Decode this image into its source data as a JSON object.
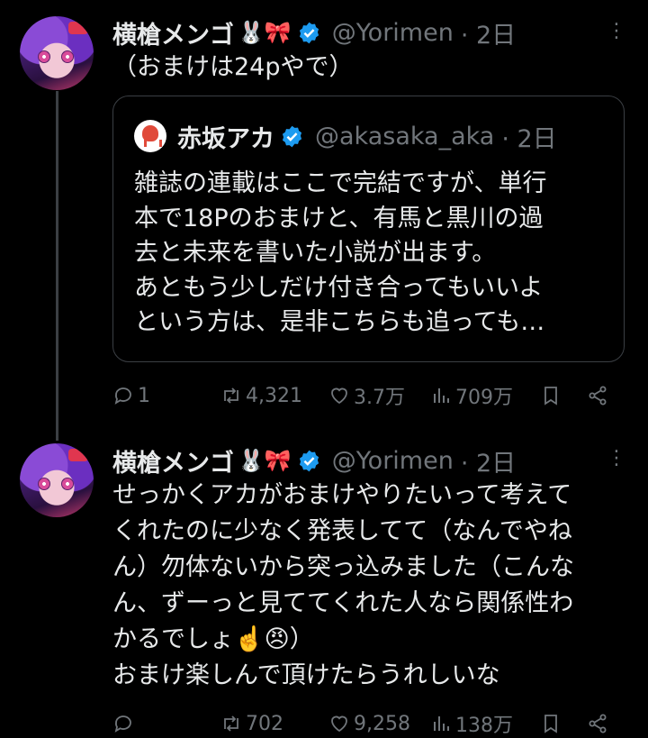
{
  "tweet1": {
    "name": "横槍メンゴ",
    "emojis": "🐰🎀",
    "handle": "@Yorimen",
    "time": "· 2日",
    "text": "（おまけは24pやで）",
    "quote": {
      "name": "赤坂アカ",
      "handle": "@akasaka_aka",
      "time": "· 2日",
      "text": "雑誌の連載はここで完結ですが、単行\n本で18Pのおまけと、有馬と黒川の過\n去と未来を書いた小説が出ます。\nあともう少しだけ付き合ってもいいよ\nという方は、是非こちらも追っても…"
    },
    "actions": {
      "replies": "1",
      "retweets": "4,321",
      "likes": "3.7万",
      "views": "709万"
    }
  },
  "tweet2": {
    "name": "横槍メンゴ",
    "emojis": "🐰🎀",
    "handle": "@Yorimen",
    "time": "· 2日",
    "text": "せっかくアカがおまけやりたいって考えて\nくれたのに少なく発表してて（なんでやね\nん）勿体ないから突っ込みました（こんな\nん、ずーっと見ててくれた人なら関係性わ\nかるでしょ☝️😠）\nおまけ楽しんで頂けたらうれしいな",
    "actions": {
      "replies": "",
      "retweets": "702",
      "likes": "9,258",
      "views": "138万"
    }
  },
  "icons": {
    "more": "more-dots-icon",
    "verified": "verified-badge-icon",
    "reply": "reply-icon",
    "retweet": "retweet-icon",
    "like": "heart-icon",
    "views": "views-icon",
    "bookmark": "bookmark-icon",
    "share": "share-icon"
  },
  "colors": {
    "background": "#000000",
    "text": "#e7e9ea",
    "muted": "#71767b",
    "verified": "#1d9bf0"
  }
}
